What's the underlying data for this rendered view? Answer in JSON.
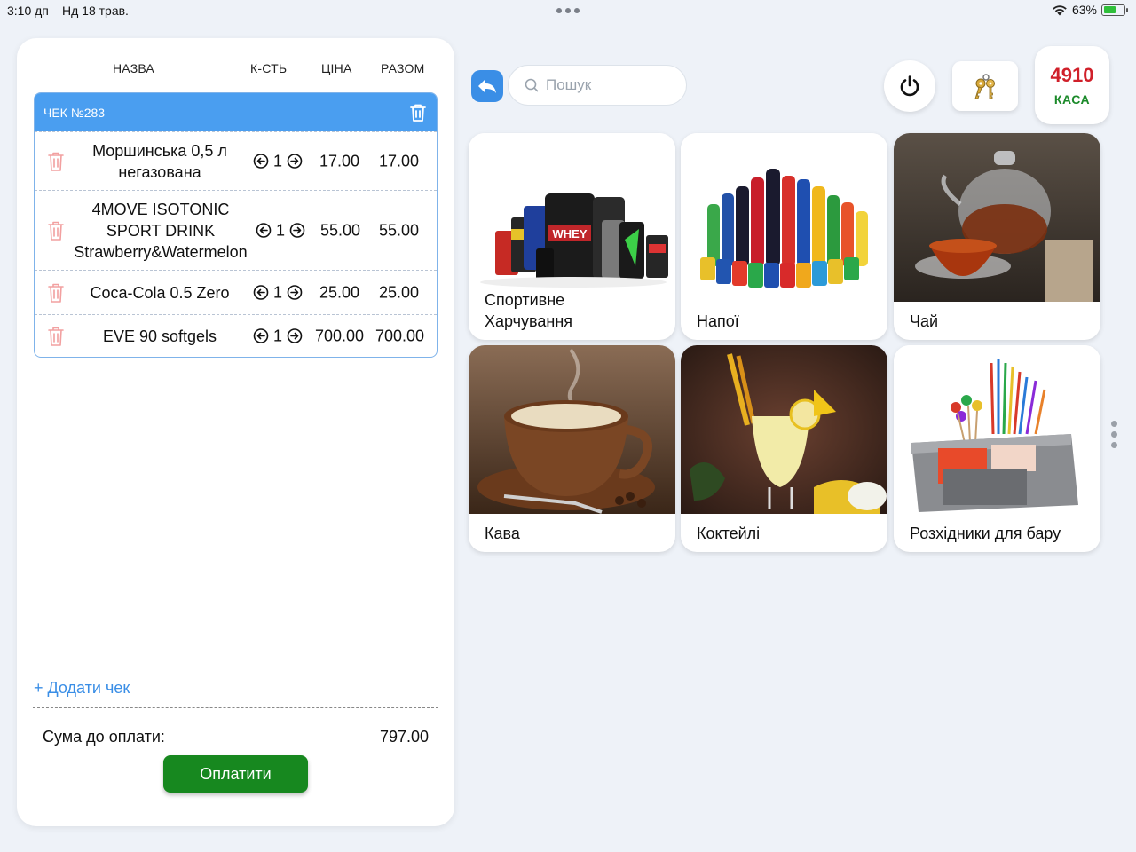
{
  "status_bar": {
    "time": "3:10 дп",
    "date": "Нд 18 трав.",
    "battery": "63%",
    "battery_level": 0.63
  },
  "receipt_panel": {
    "columns": {
      "name": "НАЗВА",
      "qty": "К-СТЬ",
      "price": "ЦІНА",
      "total": "РАЗОМ"
    },
    "receipt_title": "ЧЕК №283",
    "items": [
      {
        "name": "Моршинська 0,5 л негазована",
        "qty": "1",
        "price": "17.00",
        "total": "17.00"
      },
      {
        "name": "4MOVE ISOTONIC SPORT DRINK Strawberry&Watermelon",
        "qty": "1",
        "price": "55.00",
        "total": "55.00"
      },
      {
        "name": "Coca-Cola 0.5 Zero",
        "qty": "1",
        "price": "25.00",
        "total": "25.00"
      },
      {
        "name": "EVE 90 softgels",
        "qty": "1",
        "price": "700.00",
        "total": "700.00"
      }
    ],
    "add_receipt": "+ Додати чек",
    "sum_label": "Сума до оплати:",
    "sum_value": "797.00",
    "pay_button": "Оплатити"
  },
  "toolbar": {
    "search_placeholder": "Пошук",
    "cash_number": "4910",
    "cash_label": "КАСА"
  },
  "categories": [
    {
      "label": "Спортивне Харчування",
      "icon": "sport-nutrition-image"
    },
    {
      "label": "Напої",
      "icon": "drinks-image"
    },
    {
      "label": "Чай",
      "icon": "tea-image"
    },
    {
      "label": "Кава",
      "icon": "coffee-image"
    },
    {
      "label": "Коктейлі",
      "icon": "cocktail-image"
    },
    {
      "label": "Розхідники для бару",
      "icon": "bar-supplies-image"
    }
  ],
  "colors": {
    "accent": "#4a9ef0",
    "pay": "#17881f",
    "cash_number": "#d0202a",
    "cash_label": "#1b8a2a"
  }
}
